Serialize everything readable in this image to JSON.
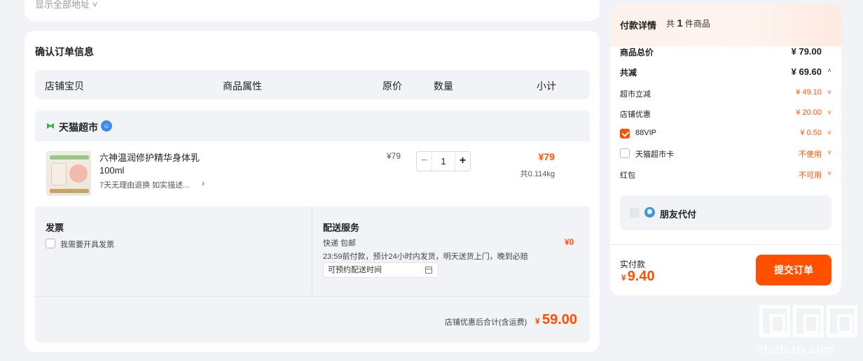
{
  "address": {
    "show_all": "显示全部地址 ˅"
  },
  "order": {
    "title": "确认订单信息",
    "columns": [
      "店铺宝贝",
      "商品属性",
      "原价",
      "数量",
      "小计"
    ],
    "shop": {
      "name": "天猫超市",
      "badge": ""
    },
    "item": {
      "title": "六神温润修护精华身体乳100ml",
      "tags": "7天无理由退换   如实描述...",
      "tags_arrow": "›",
      "price_orig": "¥79",
      "qty": "1",
      "minus": "−",
      "plus": "+",
      "subtotal": "¥79",
      "weight": "共0.114kg"
    },
    "invoice": {
      "title": "发票",
      "checkbox_label": "我需要开具发票"
    },
    "delivery": {
      "title": "配送服务",
      "method": "快递 包邮",
      "fee": "¥0",
      "note": "23:59前付款，预计24小时内发货，明天送货上门，晚到必赔",
      "time_placeholder": "可预约配送时间"
    },
    "footer": {
      "label": "店铺优惠后合计(含运费)",
      "currency": "¥",
      "amount": "59.00"
    }
  },
  "summary": {
    "title": "付款详情",
    "count_prefix": "共",
    "count": "1",
    "count_suffix": "件商品",
    "rows": {
      "total": {
        "label": "商品总价",
        "value": "¥ 79.00"
      },
      "discount": {
        "label": "共减",
        "value": "¥ 69.60",
        "chevron": "˄"
      },
      "market": {
        "label": "超市立减",
        "value": "¥ 49.10",
        "chevron": "˅"
      },
      "shop": {
        "label": "店铺优惠",
        "value": "¥ 20.00",
        "chevron": "˅"
      },
      "vip": {
        "label": "88VIP",
        "value": "¥ 0.50",
        "chevron": "˅",
        "checked": true
      },
      "card": {
        "label": "天猫超市卡",
        "value": "不使用",
        "chevron": "˅",
        "checked": false
      },
      "redpacket": {
        "label": "红包",
        "value": "不可用",
        "chevron": "˅"
      }
    },
    "friend_pay": "朋友代付",
    "pay_label": "实付款",
    "pay_currency": "¥",
    "pay_amount": "9.40",
    "submit": "提交订单"
  },
  "watermark": {
    "text": "zhizhizhi.com"
  },
  "colors": {
    "accent": "#ff5000",
    "page_bg": "#f1f3f6",
    "card_bg": "#ffffff",
    "badge_blue": "#3a8cf0",
    "shop_green": "#3bb54a"
  }
}
